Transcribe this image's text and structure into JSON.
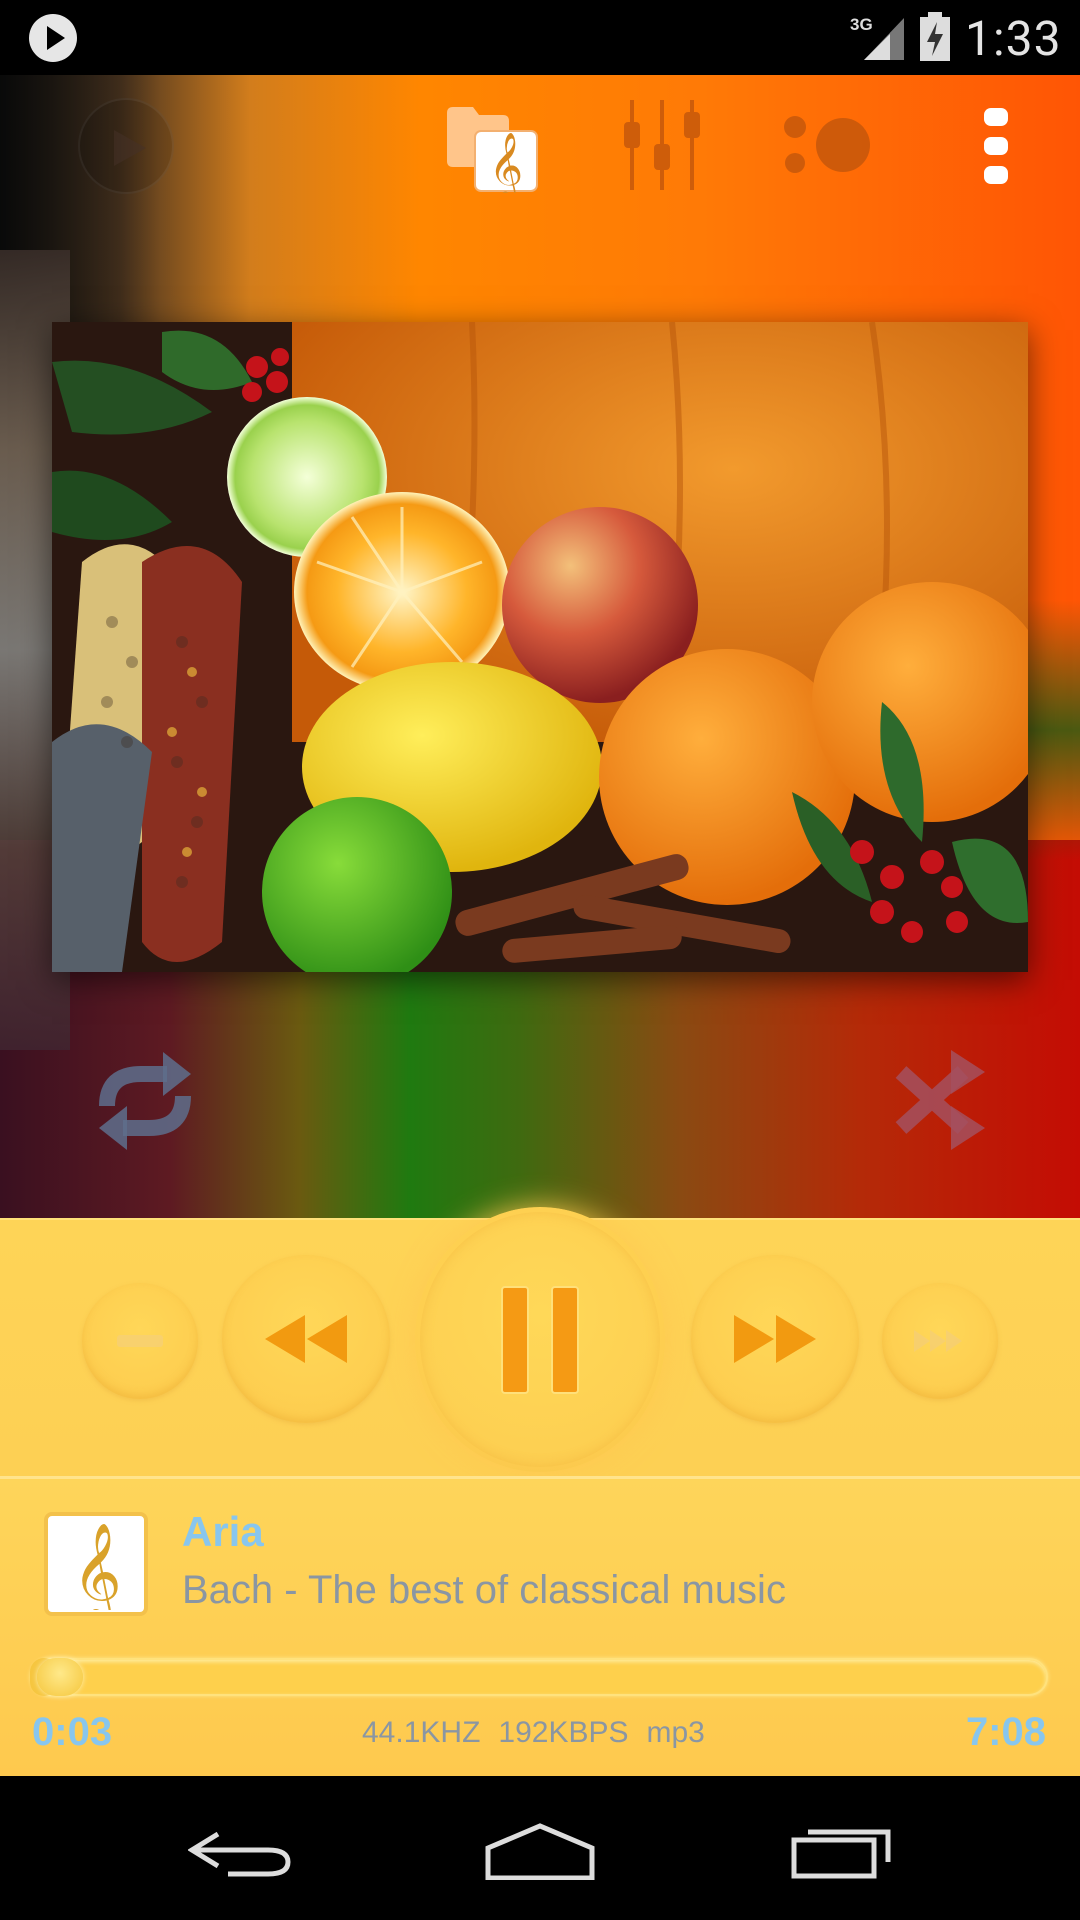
{
  "status_bar": {
    "time": "1:33",
    "network": "3G",
    "icons": [
      "play-notification-icon",
      "signal-icon",
      "battery-charging-icon"
    ]
  },
  "action_bar": {
    "icons": [
      "play-icon",
      "library-icon",
      "equalizer-icon",
      "visualizer-icon",
      "overflow-menu-icon"
    ]
  },
  "album_art": {
    "icon": "album-art-image"
  },
  "modes": {
    "icons": [
      "repeat-icon",
      "shuffle-icon"
    ]
  },
  "controls": {
    "icons": [
      "previous-track-icon",
      "rewind-icon",
      "pause-icon",
      "fast-forward-icon",
      "next-track-icon"
    ]
  },
  "track": {
    "title": "Aria",
    "album": "Bach - The best of classical music",
    "elapsed": "0:03",
    "total": "7:08",
    "sample_rate": "44.1KHZ",
    "bitrate": "192KBPS",
    "format": "mp3",
    "progress_fraction": 0.007
  },
  "nav_bar": {
    "icons": [
      "back-icon",
      "home-icon",
      "recents-icon"
    ]
  },
  "colors": {
    "accent_blue": "#88c6ee",
    "panel_yellow": "#fed457",
    "control_orange": "#f29a10",
    "meta_gray": "#8a96a3"
  }
}
